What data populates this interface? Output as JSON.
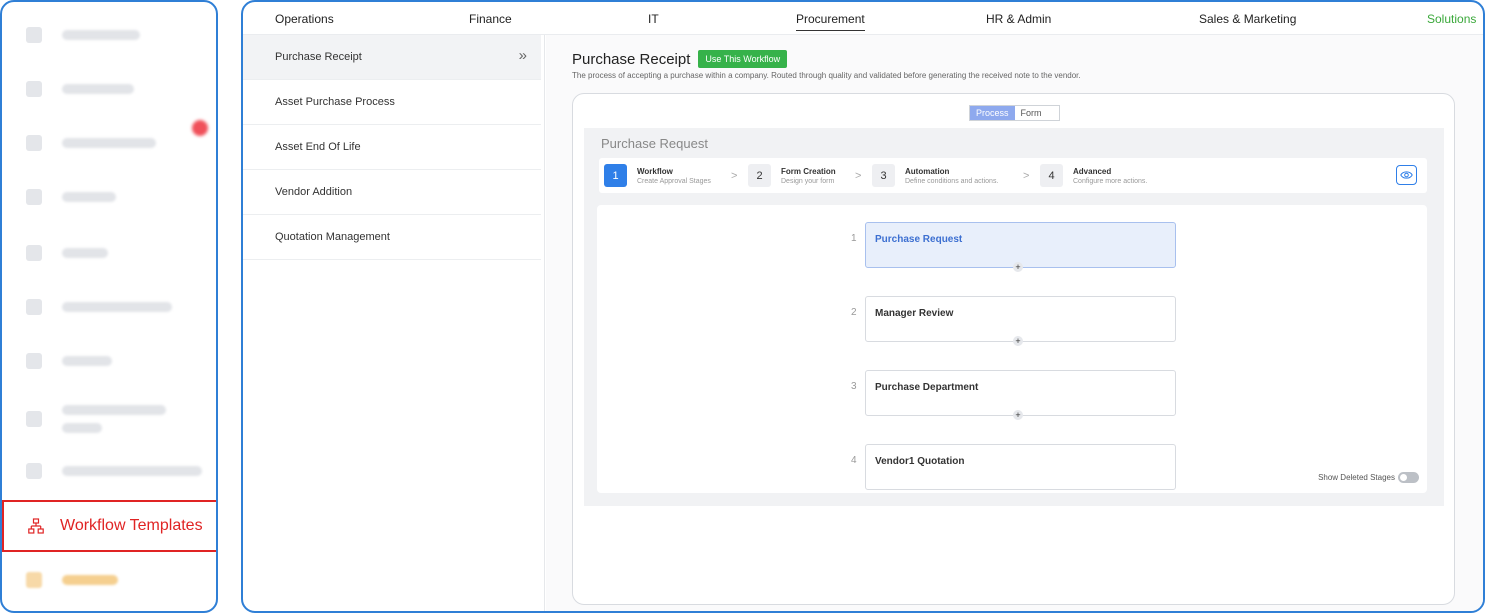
{
  "sidebar": {
    "active_item": {
      "label": "Workflow Templates",
      "icon": "sitemap-icon",
      "color": "#e02424"
    }
  },
  "topnav": {
    "tabs": [
      {
        "label": "Operations"
      },
      {
        "label": "Finance"
      },
      {
        "label": "IT"
      },
      {
        "label": "Procurement",
        "active": true
      },
      {
        "label": "HR & Admin"
      },
      {
        "label": "Sales & Marketing"
      },
      {
        "label": "Solutions",
        "color": "#3aa83a"
      }
    ]
  },
  "templates": {
    "items": [
      {
        "label": "Purchase Receipt",
        "selected": true
      },
      {
        "label": "Asset Purchase Process"
      },
      {
        "label": "Asset End Of Life"
      },
      {
        "label": "Vendor Addition"
      },
      {
        "label": "Quotation Management"
      }
    ],
    "expand_icon": "double-chevron-right-icon"
  },
  "detail": {
    "title": "Purchase Receipt",
    "use_button": "Use This Workflow",
    "description": "The process of accepting a purchase within a company. Routed through quality and validated before generating the received note to the vendor.",
    "toggle": {
      "process": "Process",
      "form": "Form",
      "selected": "Process"
    },
    "workflow_name": "Purchase Request",
    "steps": [
      {
        "num": "1",
        "title": "Workflow",
        "subtitle": "Create Approval Stages",
        "current": true
      },
      {
        "num": "2",
        "title": "Form Creation",
        "subtitle": "Design your form"
      },
      {
        "num": "3",
        "title": "Automation",
        "subtitle": "Define conditions and actions."
      },
      {
        "num": "4",
        "title": "Advanced",
        "subtitle": "Configure more actions."
      }
    ],
    "stages": [
      {
        "index": "1",
        "name": "Purchase Request",
        "selected": true
      },
      {
        "index": "2",
        "name": "Manager Review"
      },
      {
        "index": "3",
        "name": "Purchase Department"
      },
      {
        "index": "4",
        "name": "Vendor1 Quotation"
      }
    ],
    "plus_symbol": "+",
    "show_deleted_label": "Show Deleted Stages",
    "show_deleted_on": false
  },
  "colors": {
    "accent_blue": "#2f7fe8",
    "green_button": "#36b24a",
    "frame_border": "#2f7fd6"
  }
}
